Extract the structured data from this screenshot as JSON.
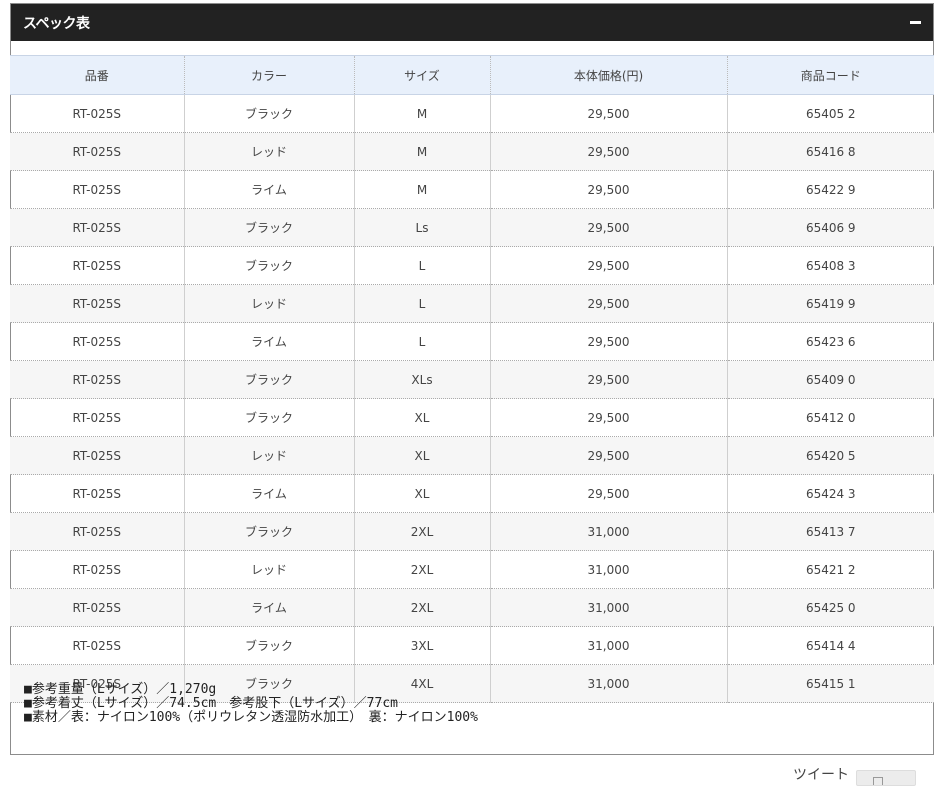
{
  "panel": {
    "title": "スペック表"
  },
  "table": {
    "headers": [
      "品番",
      "カラー",
      "サイズ",
      "本体価格(円)",
      "商品コード"
    ],
    "rows": [
      [
        "RT-025S",
        "ブラック",
        "M",
        "29,500",
        "65405 2"
      ],
      [
        "RT-025S",
        "レッド",
        "M",
        "29,500",
        "65416 8"
      ],
      [
        "RT-025S",
        "ライム",
        "M",
        "29,500",
        "65422 9"
      ],
      [
        "RT-025S",
        "ブラック",
        "Ls",
        "29,500",
        "65406 9"
      ],
      [
        "RT-025S",
        "ブラック",
        "L",
        "29,500",
        "65408 3"
      ],
      [
        "RT-025S",
        "レッド",
        "L",
        "29,500",
        "65419 9"
      ],
      [
        "RT-025S",
        "ライム",
        "L",
        "29,500",
        "65423 6"
      ],
      [
        "RT-025S",
        "ブラック",
        "XLs",
        "29,500",
        "65409 0"
      ],
      [
        "RT-025S",
        "ブラック",
        "XL",
        "29,500",
        "65412 0"
      ],
      [
        "RT-025S",
        "レッド",
        "XL",
        "29,500",
        "65420 5"
      ],
      [
        "RT-025S",
        "ライム",
        "XL",
        "29,500",
        "65424 3"
      ],
      [
        "RT-025S",
        "ブラック",
        "2XL",
        "31,000",
        "65413 7"
      ],
      [
        "RT-025S",
        "レッド",
        "2XL",
        "31,000",
        "65421 2"
      ],
      [
        "RT-025S",
        "ライム",
        "2XL",
        "31,000",
        "65425 0"
      ],
      [
        "RT-025S",
        "ブラック",
        "3XL",
        "31,000",
        "65414 4"
      ],
      [
        "RT-025S",
        "ブラック",
        "4XL",
        "31,000",
        "65415 1"
      ]
    ]
  },
  "notes": [
    "■参考重量（Lサイズ）／1,270g",
    "■参考着丈（Lサイズ）／74.5cm　参考股下（Lサイズ）／77cm",
    "■素材／表：ナイロン100%（ポリウレタン透湿防水加工）　裏：ナイロン100%"
  ],
  "footer": {
    "tweet_label": "ツイート"
  },
  "colors": {
    "header_bg": "#222222",
    "th_bg": "#e8f0fb",
    "alt_row_bg": "#f6f6f6"
  },
  "icons": {
    "collapse": "minus-icon",
    "share": "bookmark-icon"
  }
}
